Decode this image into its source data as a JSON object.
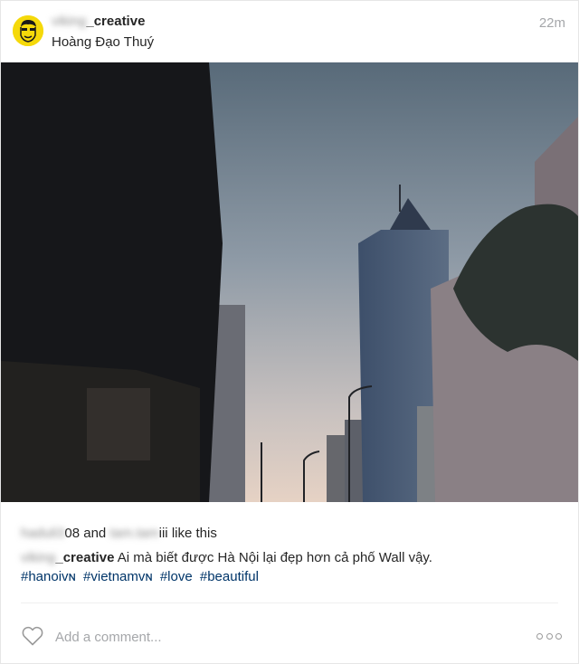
{
  "post": {
    "username_prefix": "viking",
    "username_suffix": "_creative",
    "location": "Hoàng Đạo Thuý",
    "timestamp": "22m"
  },
  "likes": {
    "user1_prefix": "haduli3",
    "user1_suffix": "08",
    "joiner": "and",
    "user2_prefix": "tam.tam",
    "user2_suffix": "iii",
    "tail": "like this"
  },
  "caption": {
    "text": "Ai mà biết được Hà Nội lại đẹp hơn cả phố Wall vậy.",
    "hashtags": [
      "#hanoiᴠɴ",
      "#vietnamᴠɴ",
      "#love",
      "#beautiful"
    ]
  },
  "comment": {
    "placeholder": "Add a comment..."
  },
  "icons": {
    "like": "heart-outline-icon",
    "more": "more-options-icon",
    "avatar": "cartoon-face-avatar"
  },
  "colors": {
    "hashtag": "#003569",
    "muted": "#a5a7aa",
    "avatar_bg": "#f5d90a"
  }
}
